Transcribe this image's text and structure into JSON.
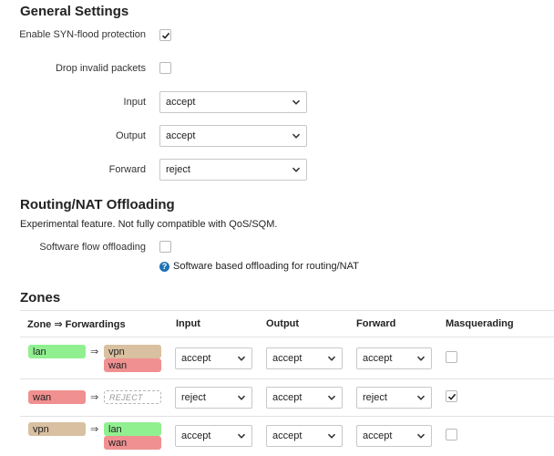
{
  "general": {
    "title": "General Settings",
    "syn_flood": {
      "label": "Enable SYN-flood protection",
      "checked": true
    },
    "drop_invalid": {
      "label": "Drop invalid packets",
      "checked": false
    },
    "input": {
      "label": "Input",
      "value": "accept"
    },
    "output": {
      "label": "Output",
      "value": "accept"
    },
    "forward": {
      "label": "Forward",
      "value": "reject"
    }
  },
  "offload": {
    "title": "Routing/NAT Offloading",
    "description": "Experimental feature. Not fully compatible with QoS/SQM.",
    "software_flow": {
      "label": "Software flow offloading",
      "checked": false
    },
    "help_text": "Software based offloading for routing/NAT",
    "help_icon": "info-icon"
  },
  "zones": {
    "title": "Zones",
    "columns": {
      "zone": "Zone ⇒ Forwardings",
      "input": "Input",
      "output": "Output",
      "forward": "Forward",
      "masq": "Masquerading"
    },
    "arrow": "⇒",
    "rows": [
      {
        "zone": "lan",
        "forwardings": [
          "vpn",
          "wan"
        ],
        "input": "accept",
        "output": "accept",
        "forward": "accept",
        "masquerading": false
      },
      {
        "zone": "wan",
        "forwardings": [
          "REJECT"
        ],
        "input": "reject",
        "output": "accept",
        "forward": "reject",
        "masquerading": true
      },
      {
        "zone": "vpn",
        "forwardings": [
          "lan",
          "wan"
        ],
        "input": "accept",
        "output": "accept",
        "forward": "accept",
        "masquerading": false
      }
    ],
    "zone_colors": {
      "lan": "#90f090",
      "vpn": "#d8c0a0",
      "wan": "#f09090"
    }
  }
}
